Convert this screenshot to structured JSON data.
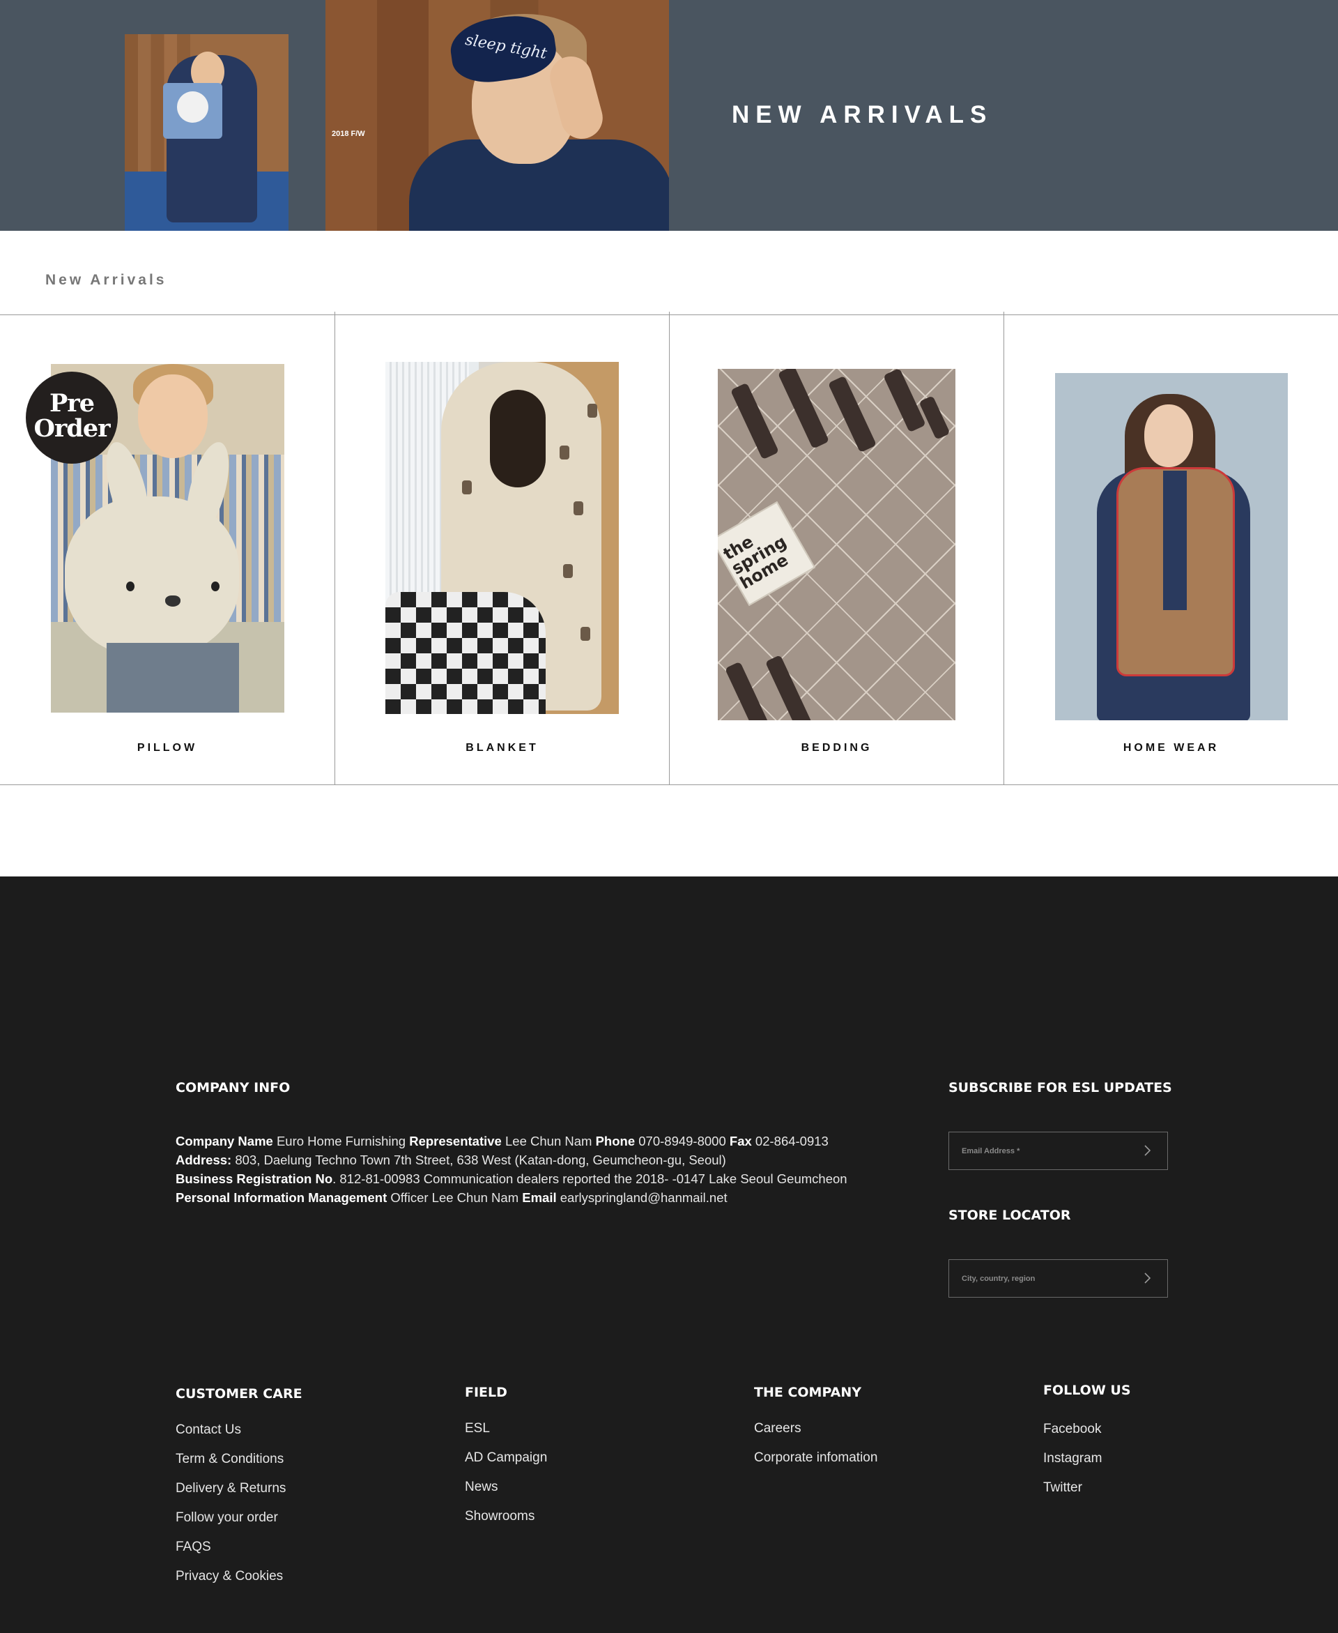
{
  "hero": {
    "title": "NEW ARRIVALS",
    "season_label": "2018 F/W",
    "mask_text": "sleep tight"
  },
  "section": {
    "title": "New Arrivals"
  },
  "products": [
    {
      "label": "PILLOW",
      "badge_line1": "Pre",
      "badge_line2": "Order"
    },
    {
      "label": "BLANKET"
    },
    {
      "label": "BEDDING",
      "tag_text_1": "the",
      "tag_text_2": "spring",
      "tag_text_3": "home"
    },
    {
      "label": "HOME WEAR"
    }
  ],
  "footer": {
    "company_info": {
      "heading": "COMPANY INFO",
      "company_name_label": "Company Name",
      "company_name": " Euro Home Furnishing ",
      "representative_label": "Representative",
      "representative": " Lee Chun Nam ",
      "phone_label": "Phone",
      "phone": " 070-8949-8000 ",
      "fax_label": "Fax",
      "fax": " 02-864-0913",
      "address_label": "Address:",
      "address": " 803, Daelung Techno Town 7th Street, 638 West (Katan-dong, Geumcheon-gu, Seoul)",
      "brn_label": "Business Registration No",
      "brn": ". 812-81-00983 Communication dealers reported the 2018- -0147 Lake Seoul Geumcheon",
      "pim_label": "Personal Information Management",
      "pim": " Officer Lee Chun Nam  ",
      "email_label": "Email",
      "email": " earlyspringland@hanmail.net"
    },
    "subscribe": {
      "heading": "SUBSCRIBE FOR ESL UPDATES",
      "placeholder": "Email Address *"
    },
    "store_locator": {
      "heading": "STORE LOCATOR",
      "placeholder": "City, country, region"
    },
    "customer_care": {
      "heading": "CUSTOMER CARE",
      "links": [
        "Contact Us",
        "Term & Conditions",
        "Delivery & Returns",
        "Follow your order",
        "FAQS",
        "Privacy & Cookies"
      ]
    },
    "field": {
      "heading": "FIELD",
      "links": [
        "ESL",
        "AD Campaign",
        "News",
        "Showrooms"
      ]
    },
    "the_company": {
      "heading": "THE COMPANY",
      "links": [
        "Careers",
        "Corporate infomation"
      ]
    },
    "follow_us": {
      "heading": "FOLLOW US",
      "links": [
        "Facebook",
        "Instagram",
        "Twitter"
      ]
    },
    "arrow_icon": "chevron-right-icon"
  }
}
